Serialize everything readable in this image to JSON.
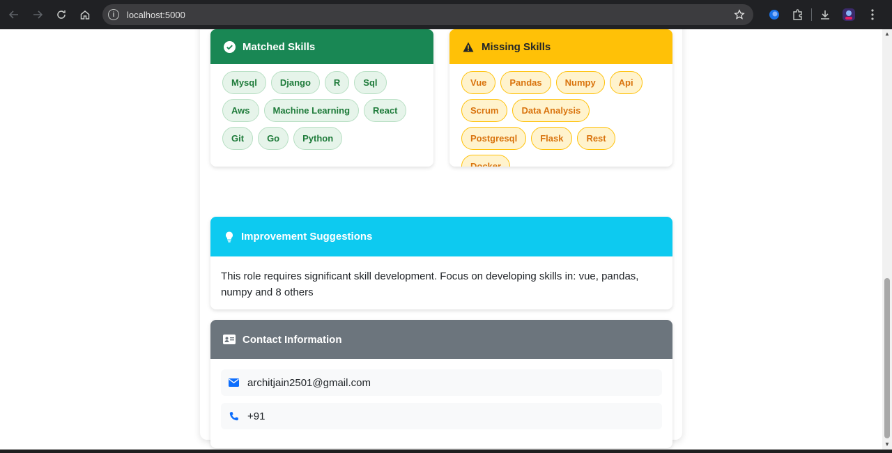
{
  "browser": {
    "url": "localhost:5000"
  },
  "matched_skills": {
    "title": "Matched Skills",
    "tags": [
      "Mysql",
      "Django",
      "R",
      "Sql",
      "Aws",
      "Machine Learning",
      "React",
      "Git",
      "Go",
      "Python"
    ]
  },
  "missing_skills": {
    "title": "Missing Skills",
    "tags": [
      "Vue",
      "Pandas",
      "Numpy",
      "Api",
      "Scrum",
      "Data Analysis",
      "Postgresql",
      "Flask",
      "Rest",
      "Docker"
    ]
  },
  "suggestions": {
    "title": "Improvement Suggestions",
    "text": "This role requires significant skill development. Focus on developing skills in: vue, pandas, numpy and 8 others"
  },
  "contact": {
    "title": "Contact Information",
    "email": "architjain2501@gmail.com",
    "phone": "+91"
  },
  "colors": {
    "matched_header": "#198754",
    "missing_header": "#ffc107",
    "suggestions_header": "#0dcaf0",
    "contact_header": "#6c757d"
  },
  "icons": {
    "matched": "check-circle-icon",
    "missing": "warning-triangle-icon",
    "suggestions": "lightbulb-icon",
    "contact": "id-card-icon",
    "email": "envelope-icon",
    "phone": "phone-icon"
  }
}
